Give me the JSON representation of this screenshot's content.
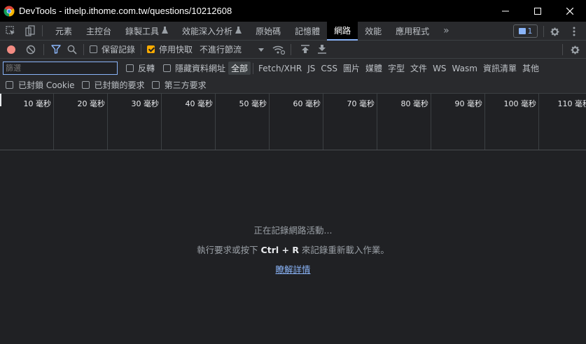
{
  "window": {
    "title": "DevTools - ithelp.ithome.com.tw/questions/10212608",
    "minimize_icon": "minimize-icon",
    "maximize_icon": "maximize-icon",
    "close_icon": "close-icon"
  },
  "tabs": [
    {
      "label": "元素"
    },
    {
      "label": "主控台"
    },
    {
      "label": "錄製工具",
      "experimental": true
    },
    {
      "label": "效能深入分析",
      "experimental": true
    },
    {
      "label": "原始碼"
    },
    {
      "label": "記憶體"
    },
    {
      "label": "網路",
      "active": true
    },
    {
      "label": "效能"
    },
    {
      "label": "應用程式"
    }
  ],
  "more_tabs": "»",
  "issues_count": "1",
  "toolbar": {
    "preserve_log": "保留記錄",
    "disable_cache": "停用快取",
    "throttling": "不進行節流",
    "preserve_log_checked": false,
    "disable_cache_checked": true
  },
  "filter": {
    "placeholder": "篩選",
    "invert": "反轉",
    "hide_data_urls": "隱藏資料網址",
    "types": [
      "全部",
      "Fetch/XHR",
      "JS",
      "CSS",
      "圖片",
      "媒體",
      "字型",
      "文件",
      "WS",
      "Wasm",
      "資訊清單",
      "其他"
    ],
    "active_type": "全部",
    "blocked_cookies": "已封鎖 Cookie",
    "blocked_requests": "已封鎖的要求",
    "third_party": "第三方要求"
  },
  "timeline": {
    "ticks": [
      "10 毫秒",
      "20 毫秒",
      "30 毫秒",
      "40 毫秒",
      "50 毫秒",
      "60 毫秒",
      "70 毫秒",
      "80 毫秒",
      "90 毫秒",
      "100 毫秒",
      "110 毫秒"
    ]
  },
  "empty_state": {
    "recording": "正在記錄網路活動...",
    "hint_before": "執行要求或按下 ",
    "hint_shortcut": "Ctrl + R",
    "hint_after": " 來記錄重新載入作業。",
    "learn_more": "瞭解詳情"
  },
  "colors": {
    "accent": "#8ab4f8",
    "record": "#f28b82",
    "checkbox_checked": "#f9ab00"
  }
}
